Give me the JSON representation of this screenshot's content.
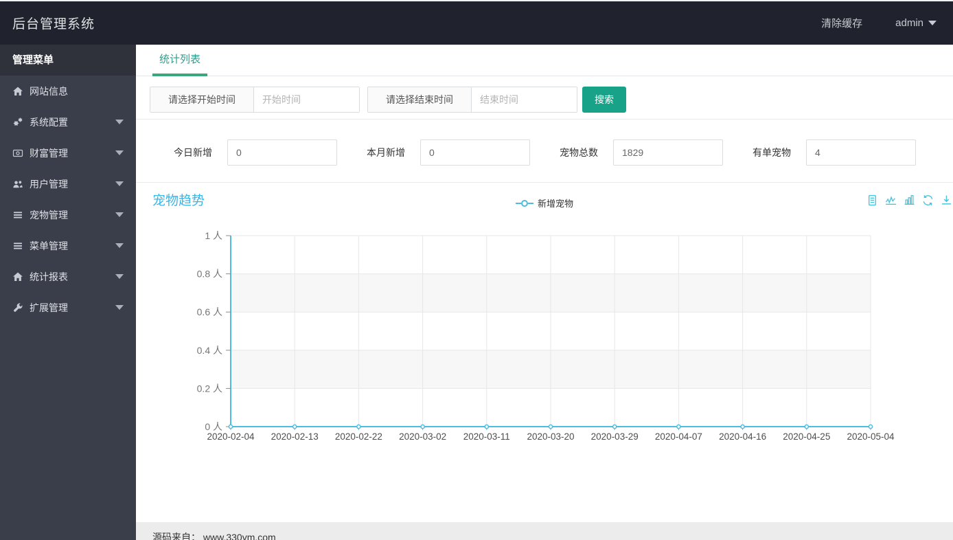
{
  "theme": {
    "topbar_bg": "#20232d",
    "sidebar_bg": "#3a3e4a",
    "sidebar_header_bg": "#2f323b",
    "accent_green": "#18a287",
    "tab_green": "#2f9e8a",
    "chart_title_blue": "#3bb4e6",
    "chart_line_cyan": "#4dbcdf",
    "toolbox_cyan": "#49c4de",
    "grid_gray": "#e7e7e7",
    "band_gray": "#f7f7f7"
  },
  "topbar": {
    "title": "后台管理系统",
    "clear_cache_label": "清除缓存",
    "username": "admin"
  },
  "sidebar": {
    "header": "管理菜单",
    "items": [
      {
        "key": "site-info",
        "label": "网站信息",
        "icon": "home-icon",
        "has_children": false
      },
      {
        "key": "system-config",
        "label": "系统配置",
        "icon": "gears-icon",
        "has_children": true
      },
      {
        "key": "wealth",
        "label": "财富管理",
        "icon": "money-icon",
        "has_children": true
      },
      {
        "key": "users",
        "label": "用户管理",
        "icon": "users-icon",
        "has_children": true
      },
      {
        "key": "pets",
        "label": "宠物管理",
        "icon": "list-icon",
        "has_children": true
      },
      {
        "key": "menus",
        "label": "菜单管理",
        "icon": "list-icon",
        "has_children": true
      },
      {
        "key": "reports",
        "label": "统计报表",
        "icon": "home-icon",
        "has_children": true
      },
      {
        "key": "extensions",
        "label": "扩展管理",
        "icon": "wrench-icon",
        "has_children": true
      }
    ]
  },
  "tabbar": {
    "tabs": [
      {
        "label": "统计列表",
        "active": true
      }
    ]
  },
  "search": {
    "start_label": "请选择开始时间",
    "start_placeholder": "开始时间",
    "end_label": "请选择结束时间",
    "end_placeholder": "结束时间",
    "button_label": "搜索"
  },
  "stats": {
    "fields": [
      {
        "key": "today-new",
        "label": "今日新增",
        "value": "0"
      },
      {
        "key": "month-new",
        "label": "本月新增",
        "value": "0"
      },
      {
        "key": "pet-total",
        "label": "宠物总数",
        "value": "1829"
      },
      {
        "key": "order-pets",
        "label": "有单宠物",
        "value": "4"
      }
    ]
  },
  "chart_data": {
    "type": "line",
    "title": "宠物趋势",
    "legend": [
      "新增宠物"
    ],
    "legend_position": "top-center",
    "x": [
      "2020-02-04",
      "2020-02-13",
      "2020-02-22",
      "2020-03-02",
      "2020-03-11",
      "2020-03-20",
      "2020-03-29",
      "2020-04-07",
      "2020-04-16",
      "2020-04-25",
      "2020-05-04"
    ],
    "series": [
      {
        "name": "新增宠物",
        "values": [
          0,
          0,
          0,
          0,
          0,
          0,
          0,
          0,
          0,
          0,
          0
        ]
      }
    ],
    "ylim": [
      0,
      1
    ],
    "y_ticks": [
      "0 人",
      "0.2 人",
      "0.4 人",
      "0.6 人",
      "0.8 人",
      "1 人"
    ],
    "ylabel_suffix": "人",
    "grid": true,
    "split_area": true,
    "toolbox_icons": [
      "data-view-icon",
      "line-type-icon",
      "bar-type-icon",
      "restore-icon",
      "save-image-icon"
    ]
  },
  "footer": {
    "text": "源码来自： www.330ym.com"
  }
}
